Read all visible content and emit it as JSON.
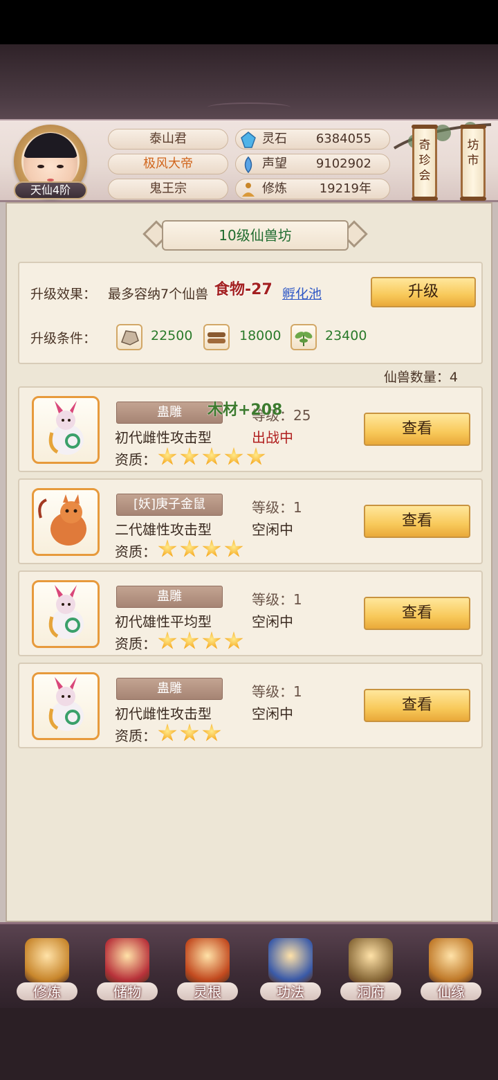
{
  "player": {
    "rank": "天仙4阶",
    "names": [
      "泰山君",
      "极风大帝",
      "鬼王宗"
    ]
  },
  "stats": [
    {
      "icon": "spirit-stone-icon",
      "label": "灵石",
      "value": "6384055"
    },
    {
      "icon": "reputation-icon",
      "label": "声望",
      "value": "9102902"
    },
    {
      "icon": "cultivation-icon",
      "label": "修炼",
      "value": "19219年"
    }
  ],
  "side_buttons": [
    "奇\n珍\n会",
    "坊\n市"
  ],
  "panel": {
    "title": "10级仙兽坊",
    "upgrade_effect_label": "升级效果：",
    "upgrade_effect_text": "最多容纳7个仙兽",
    "upgrade_link": "孵化池",
    "upgrade_button": "升级",
    "upgrade_cond_label": "升级条件：",
    "resources": [
      {
        "icon": "stone-resource-icon",
        "value": "22500"
      },
      {
        "icon": "wood-resource-icon",
        "value": "18000"
      },
      {
        "icon": "herb-resource-icon",
        "value": "23400"
      }
    ],
    "float_food": "食物-27",
    "float_wood": "木材+208",
    "beast_count_label": "仙兽数量：4"
  },
  "beasts": [
    {
      "name": "蛊雕",
      "type": "初代雌性攻击型",
      "level": "等级：25",
      "status": "出战中",
      "status_color": "#b01e1e",
      "stars": 5,
      "view": "查看",
      "aptitude": "资质："
    },
    {
      "name": "[妖]庚子金鼠",
      "type": "二代雄性攻击型",
      "level": "等级：1",
      "status": "空闲中",
      "status_color": "#3a2a20",
      "stars": 4,
      "view": "查看",
      "aptitude": "资质："
    },
    {
      "name": "蛊雕",
      "type": "初代雄性平均型",
      "level": "等级：1",
      "status": "空闲中",
      "status_color": "#3a2a20",
      "stars": 4,
      "view": "查看",
      "aptitude": "资质："
    },
    {
      "name": "蛊雕",
      "type": "初代雌性攻击型",
      "level": "等级：1",
      "status": "空闲中",
      "status_color": "#3a2a20",
      "stars": 3,
      "view": "查看",
      "aptitude": "资质："
    }
  ],
  "nav": [
    {
      "label": "修炼",
      "icon": "cultivate-icon",
      "color": "#c8862c"
    },
    {
      "label": "储物",
      "icon": "storage-bag-icon",
      "color": "#b8323a"
    },
    {
      "label": "灵根",
      "icon": "spirit-root-icon",
      "color": "#c24a1f"
    },
    {
      "label": "功法",
      "icon": "technique-book-icon",
      "color": "#3a5aa8"
    },
    {
      "label": "洞府",
      "icon": "cave-house-icon",
      "color": "#8a6b3a"
    },
    {
      "label": "仙缘",
      "icon": "gourd-icon",
      "color": "#c07a2a"
    }
  ]
}
